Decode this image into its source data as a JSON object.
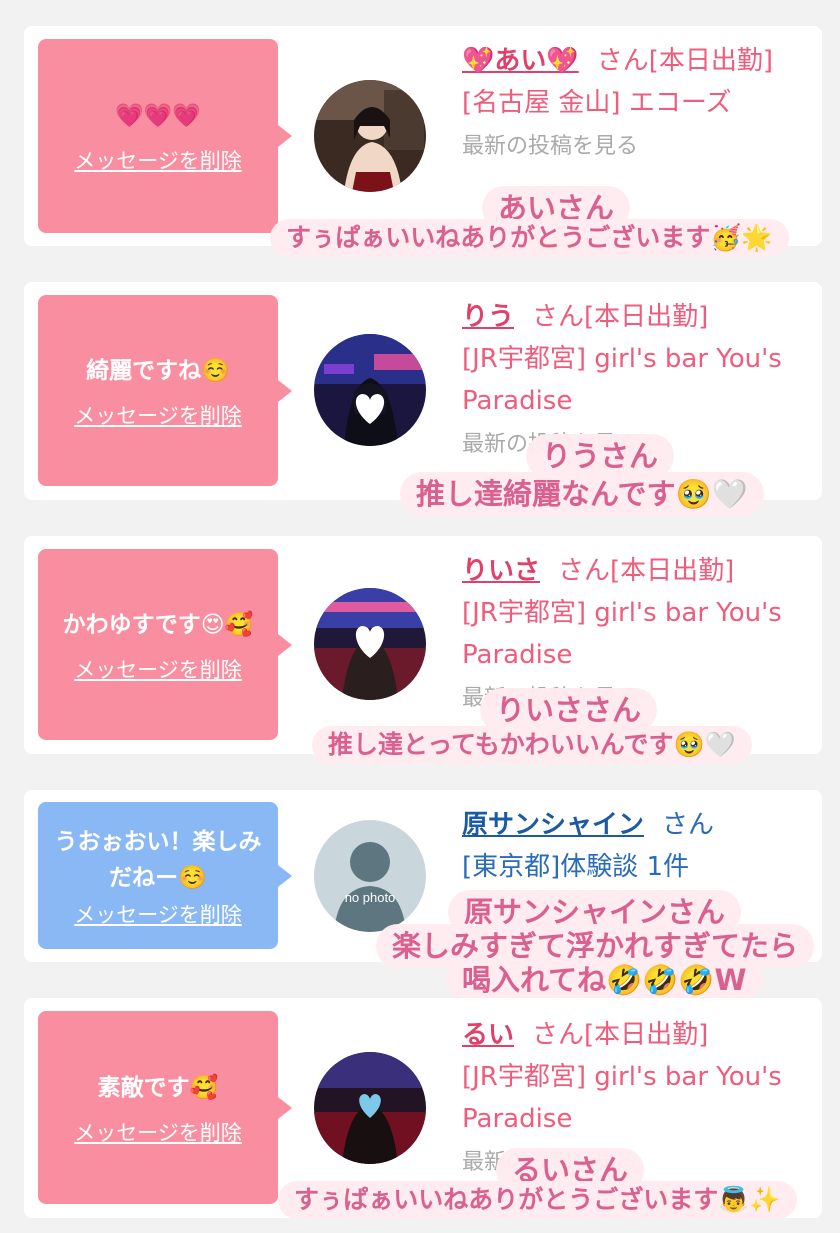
{
  "delete_label": "メッセージを削除",
  "san_suffix": "さん",
  "cards": [
    {
      "message": "💗💗💗",
      "name": "💖あい💖",
      "status": "[本日出勤]",
      "shop": "[名古屋 金山] エコーズ",
      "latest": "最新の投稿を見る",
      "sticker_name": "あいさん",
      "sticker_text": "すぅぱぁいいねありがとうございます🥳🌟"
    },
    {
      "message": "綺麗ですね☺️",
      "name": "りう",
      "status": "[本日出勤]",
      "shop": "[JR宇都宮] girl's bar You's Paradise",
      "latest": "最新の投稿を見る",
      "sticker_name": "りうさん",
      "sticker_text": "推し達綺麗なんです🥹🤍"
    },
    {
      "message": "かわゆすです😍🥰",
      "name": "りいさ",
      "status": "[本日出勤]",
      "shop": "[JR宇都宮] girl's bar You's Paradise",
      "latest": "最新の投稿を見る",
      "sticker_name": "りいささん",
      "sticker_text": "推し達とってもかわいいんです🥹🤍"
    },
    {
      "message": "うおぉおい！楽しみだねー☺️",
      "name": "原サンシャイン",
      "status": "",
      "shop": "[東京都]体験談 1件",
      "avatar_text": "no photo",
      "sticker_name": "原サンシャインさん",
      "sticker_line2": "楽しみすぎて浮かれすぎてたら",
      "sticker_line3": "喝入れてね🤣🤣🤣W"
    },
    {
      "message": "素敵です🥰",
      "name": "るい",
      "status": "[本日出勤]",
      "shop": "[JR宇都宮] girl's bar You's Paradise",
      "latest": "最新の投稿を見る",
      "sticker_name": "るいさん",
      "sticker_text": "すぅぱぁいいねありがとうございます👼✨"
    }
  ]
}
